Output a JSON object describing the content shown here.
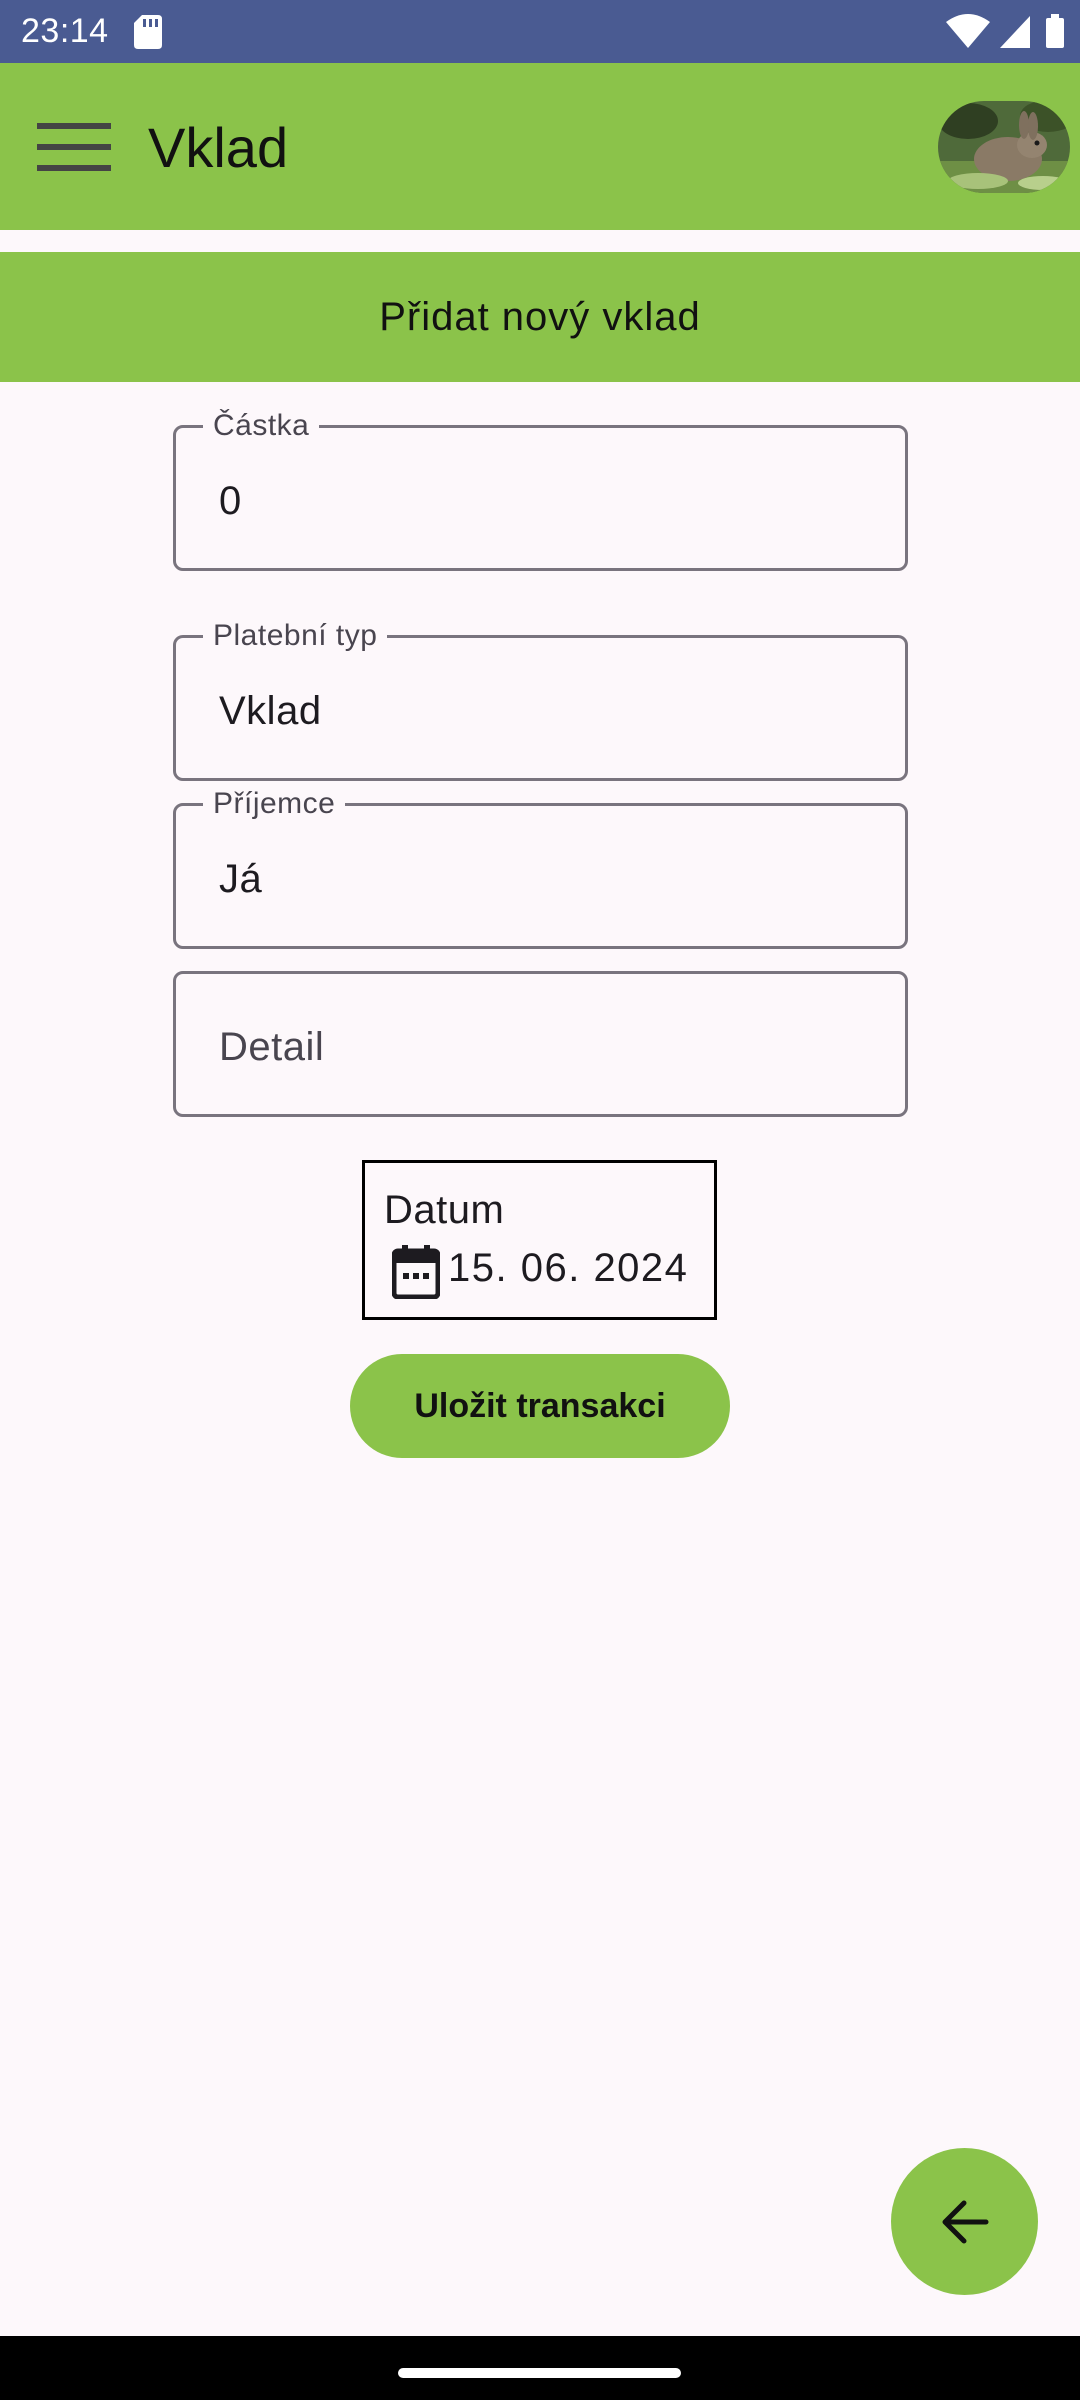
{
  "status_bar": {
    "time": "23:14",
    "icons": [
      "sd-card-icon",
      "wifi-icon",
      "signal-icon",
      "battery-icon"
    ]
  },
  "app_bar": {
    "title": "Vklad",
    "menu_icon": "hamburger-menu-icon",
    "avatar": "rabbit-avatar-image",
    "color": "#8BC34A"
  },
  "banner": {
    "text": "Přidat nový vklad"
  },
  "form": {
    "amount": {
      "label": "Částka",
      "value": "0"
    },
    "payment_type": {
      "label": "Platební typ",
      "value": "Vklad"
    },
    "recipient": {
      "label": "Příjemce",
      "value": "Já"
    },
    "detail": {
      "placeholder": "Detail",
      "value": ""
    },
    "date": {
      "label": "Datum",
      "value": "15. 06. 2024",
      "icon": "calendar-icon"
    },
    "save_label": "Uložit transakci"
  },
  "fab": {
    "icon": "arrow-back-icon"
  },
  "colors": {
    "accent": "#8BC34A",
    "status_bar": "#4A5B92",
    "background": "#FDF8FB",
    "outline": "#79747E"
  }
}
